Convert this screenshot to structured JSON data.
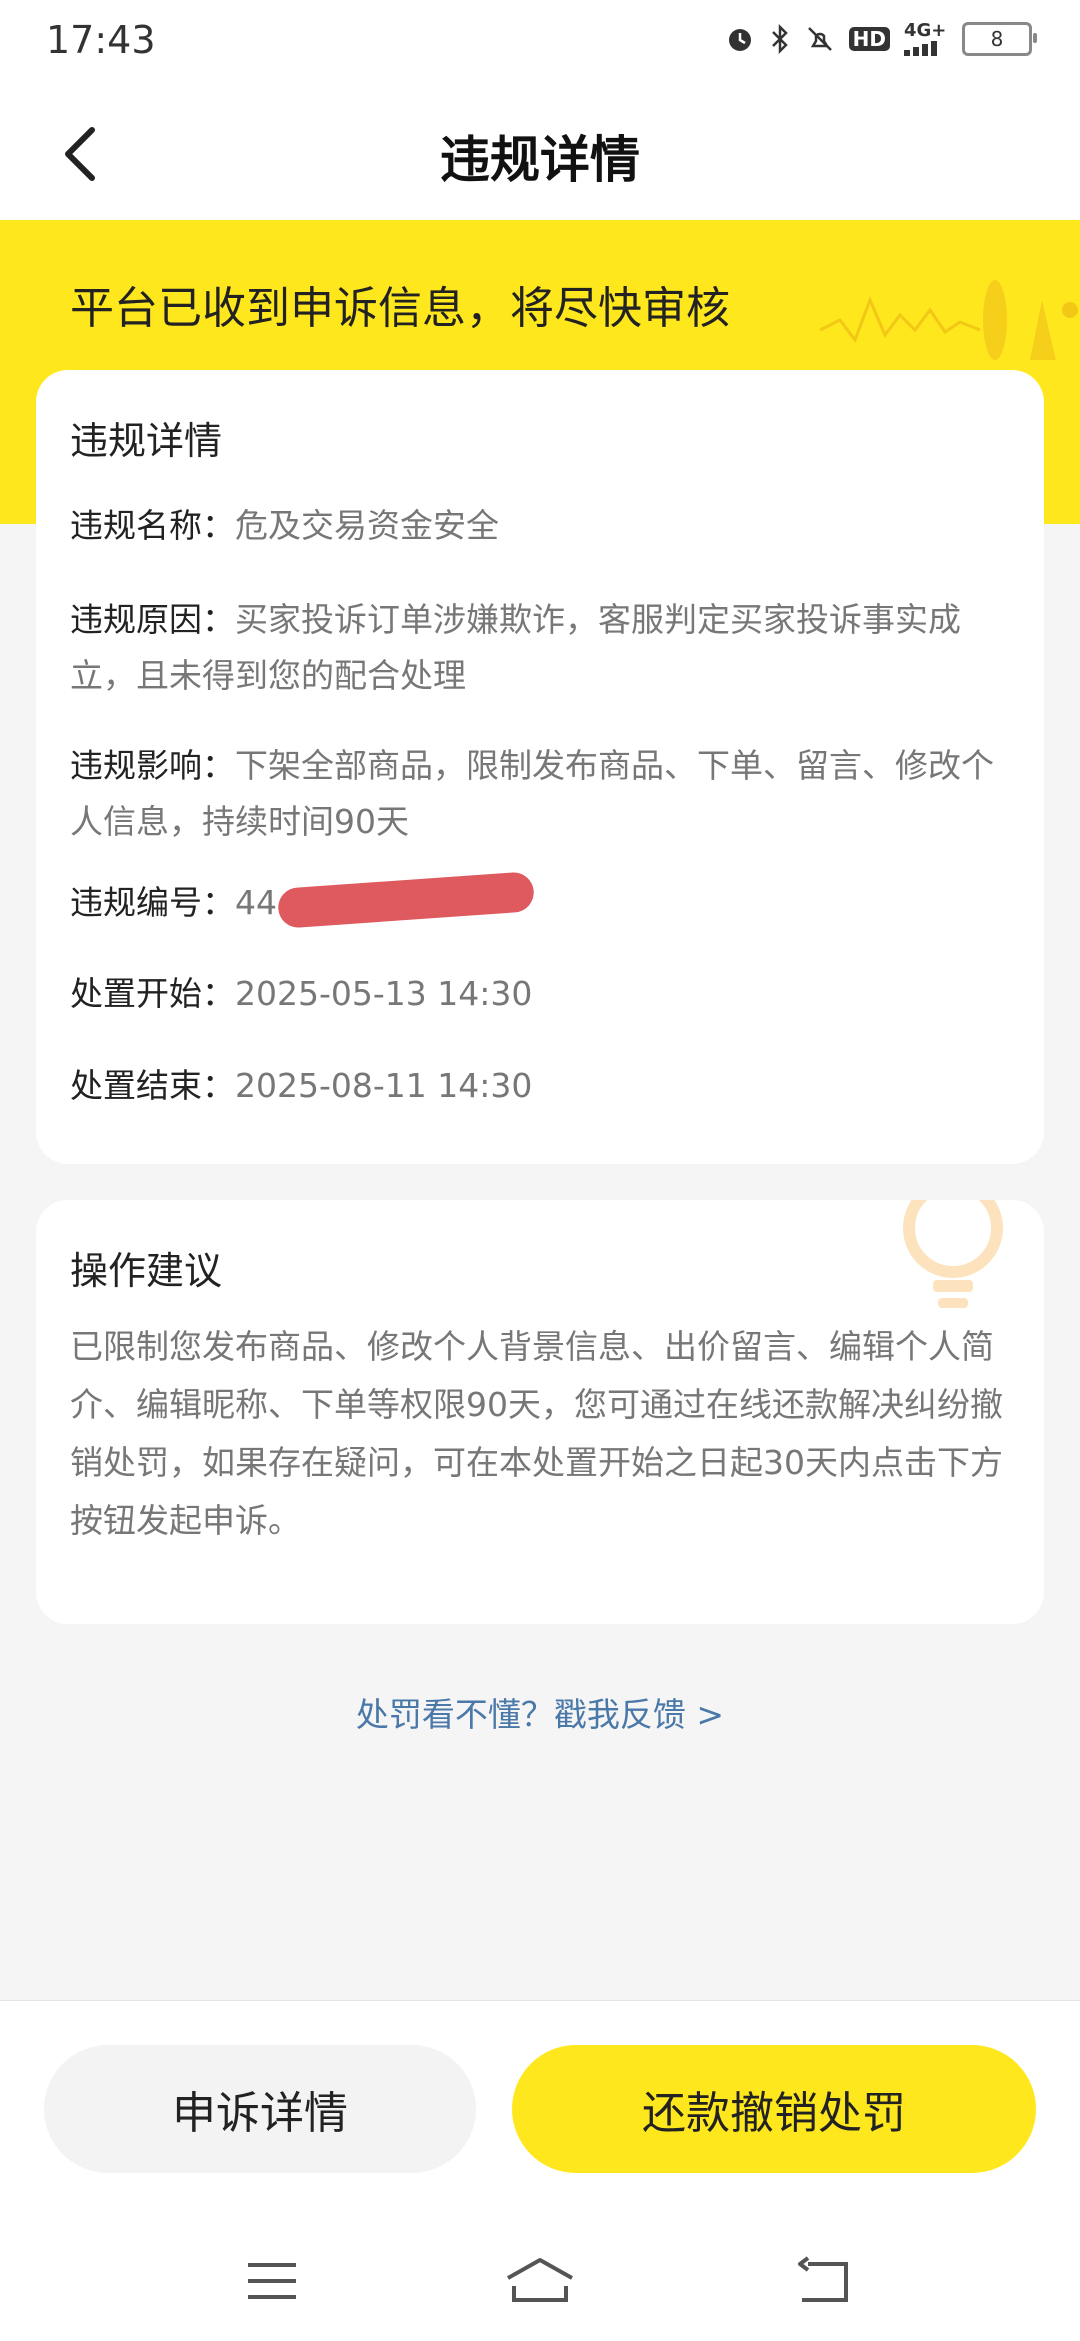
{
  "status_bar": {
    "time": "17:43",
    "network_label": "4G+",
    "hd_label": "HD",
    "battery_level": "8",
    "icons": [
      "alarm-icon",
      "bluetooth-icon",
      "mute-icon",
      "hd-icon",
      "signal-icon",
      "battery-icon"
    ]
  },
  "nav": {
    "title": "违规详情",
    "back_icon": "chevron-left-icon"
  },
  "banner": {
    "text": "平台已收到申诉信息，将尽快审核"
  },
  "violation_card": {
    "title": "违规详情",
    "rows": [
      {
        "label": "违规名称：",
        "value": "危及交易资金安全"
      },
      {
        "label": "违规原因：",
        "value": "买家投诉订单涉嫌欺诈，客服判定买家投诉事实成立，且未得到您的配合处理"
      },
      {
        "label": "违规影响：",
        "value": "下架全部商品，限制发布商品、下单、留言、修改个人信息，持续时间90天"
      },
      {
        "label": "违规编号：",
        "value": "44"
      },
      {
        "label": "处置开始：",
        "value": "2025-05-13 14:30"
      },
      {
        "label": "处置结束：",
        "value": "2025-08-11 14:30"
      }
    ]
  },
  "suggestion_card": {
    "title": "操作建议",
    "text": "已限制您发布商品、修改个人背景信息、出价留言、编辑个人简介、编辑昵称、下单等权限90天，您可通过在线还款解决纠纷撤销处罚，如果存在疑问，可在本处置开始之日起30天内点击下方按钮发起申诉。"
  },
  "feedback": {
    "text": "处罚看不懂？戳我反馈 >"
  },
  "bottom": {
    "appeal_label": "申诉详情",
    "repay_label": "还款撤销处罚"
  },
  "colors": {
    "brand_yellow": "#ffe71d",
    "link_blue": "#4a78a8",
    "redaction_red": "#de5a5f",
    "page_bg": "#f5f5f5"
  }
}
